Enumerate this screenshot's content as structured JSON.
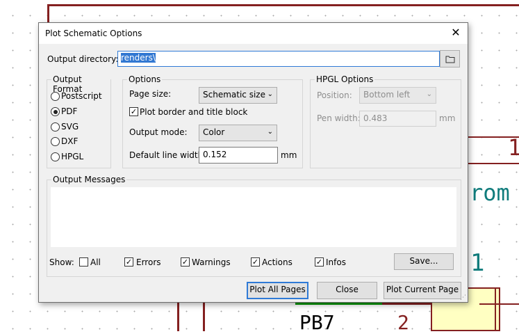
{
  "background": {
    "text_rom": "rom",
    "text_1_right": "1",
    "text_1_teal": "1",
    "text_pb7": "PB7",
    "text_2": "2"
  },
  "dialog": {
    "title": "Plot Schematic Options",
    "output_directory_label": "Output directory:",
    "output_directory_value": "renders\\",
    "output_format": {
      "title": "Output Format",
      "options": [
        "Postscript",
        "PDF",
        "SVG",
        "DXF",
        "HPGL"
      ],
      "selected": "PDF"
    },
    "options": {
      "title": "Options",
      "page_size_label": "Page size:",
      "page_size_value": "Schematic size",
      "plot_border_label": "Plot border and title block",
      "output_mode_label": "Output mode:",
      "output_mode_value": "Color",
      "line_width_label": "Default line width:",
      "line_width_value": "0.152",
      "line_width_unit": "mm"
    },
    "hpgl": {
      "title": "HPGL Options",
      "position_label": "Position:",
      "position_value": "Bottom left",
      "pen_width_label": "Pen width:",
      "pen_width_value": "0.483",
      "pen_width_unit": "mm"
    },
    "messages": {
      "title": "Output Messages",
      "show_label": "Show:",
      "filters": [
        {
          "label": "All",
          "checked": false
        },
        {
          "label": "Errors",
          "checked": true
        },
        {
          "label": "Warnings",
          "checked": true
        },
        {
          "label": "Actions",
          "checked": true
        },
        {
          "label": "Infos",
          "checked": true
        }
      ],
      "save_label": "Save..."
    },
    "buttons": {
      "plot_all": "Plot All Pages",
      "close": "Close",
      "plot_current": "Plot Current Page"
    }
  },
  "colors": {
    "wire": "#842020",
    "teal_text": "#107c7c",
    "green_wire": "#009900",
    "accent": "#2f7ad6",
    "component_fill": "#ffffc2"
  }
}
